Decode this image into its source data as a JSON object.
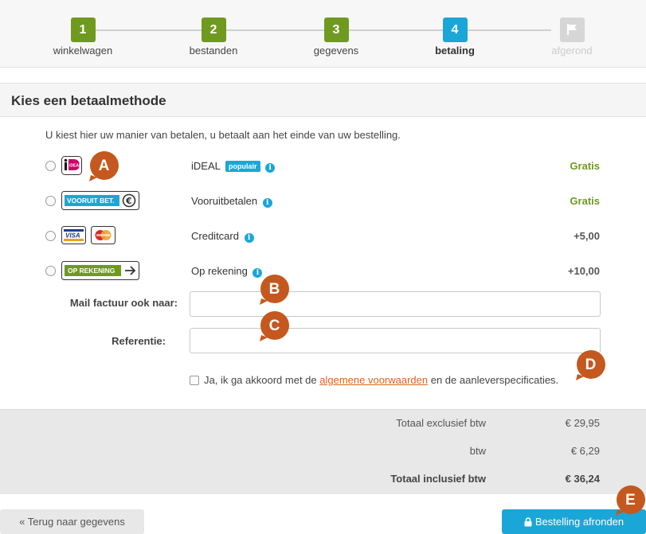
{
  "stepper": {
    "steps": [
      {
        "number": "1",
        "label": "winkelwagen",
        "state": "done"
      },
      {
        "number": "2",
        "label": "bestanden",
        "state": "done"
      },
      {
        "number": "3",
        "label": "gegevens",
        "state": "done"
      },
      {
        "number": "4",
        "label": "betaling",
        "state": "active"
      },
      {
        "number": "",
        "label": "afgerond",
        "state": "todo",
        "icon": "flag-icon"
      }
    ]
  },
  "panel": {
    "title": "Kies een betaalmethode",
    "intro": "U kiest hier uw manier van betalen, u betaalt aan het einde van uw bestelling."
  },
  "methods": [
    {
      "name": "iDEAL",
      "badge": "populair",
      "price": "Gratis",
      "logo": "ideal-logo"
    },
    {
      "name": "Vooruitbetalen",
      "price": "Gratis",
      "logo": "vooruit-betalen-logo",
      "logo_text": "VOORUIT BET."
    },
    {
      "name": "Creditcard",
      "price": "+5,00",
      "logo": "creditcard-logos",
      "logo_text": "VISA"
    },
    {
      "name": "Op rekening",
      "price": "+10,00",
      "logo": "op-rekening-logo",
      "logo_text": "OP REKENING"
    }
  ],
  "form": {
    "mail_label": "Mail factuur ook naar:",
    "mail_value": "",
    "reference_label": "Referentie:",
    "reference_value": ""
  },
  "terms": {
    "prefix": "Ja, ik ga akkoord met de ",
    "link": "algemene voorwaarden",
    "suffix": " en de aanleverspecificaties."
  },
  "totals": {
    "excl_label": "Totaal exclusief btw",
    "excl_value": "€ 29,95",
    "vat_label": "btw",
    "vat_value": "€ 6,29",
    "incl_label": "Totaal inclusief btw",
    "incl_value": "€ 36,24"
  },
  "buttons": {
    "back": "« Terug naar gegevens",
    "submit": "Bestelling afronden"
  },
  "markers": [
    "A",
    "B",
    "C",
    "D",
    "E"
  ],
  "colors": {
    "green": "#6f9a1f",
    "blue": "#1ba6d8",
    "orange_marker": "#c4581f",
    "link_orange": "#d7651c"
  }
}
